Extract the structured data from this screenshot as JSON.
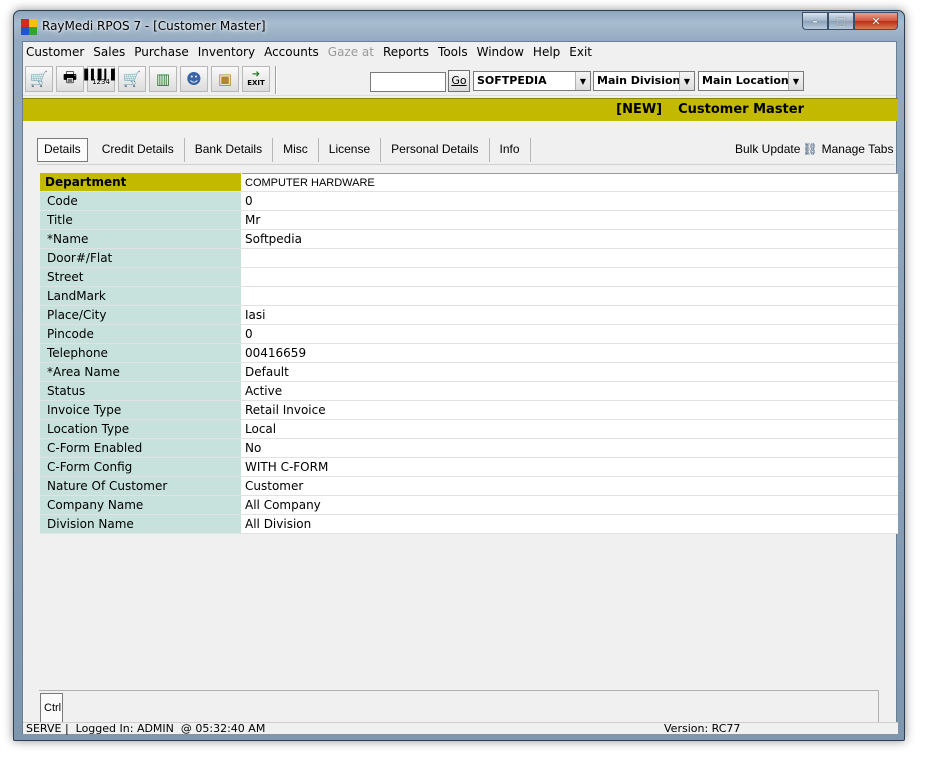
{
  "window": {
    "title": "RayMedi RPOS 7 - [Customer Master]",
    "controls": {
      "minimize": "–",
      "maximize": "□",
      "close": "✕"
    }
  },
  "menu": [
    {
      "label": "Customer",
      "disabled": false
    },
    {
      "label": "Sales",
      "disabled": false
    },
    {
      "label": "Purchase",
      "disabled": false
    },
    {
      "label": "Inventory",
      "disabled": false
    },
    {
      "label": "Accounts",
      "disabled": false
    },
    {
      "label": "Gaze at",
      "disabled": true
    },
    {
      "label": "Reports",
      "disabled": false
    },
    {
      "label": "Tools",
      "disabled": false
    },
    {
      "label": "Window",
      "disabled": false
    },
    {
      "label": "Help",
      "disabled": false
    },
    {
      "label": "Exit",
      "disabled": false
    }
  ],
  "toolbar": {
    "icons": [
      "cart-icon",
      "printer-icon",
      "barcode-icon",
      "cart-add-icon",
      "books-icon",
      "users-icon",
      "box-icon",
      "exit-icon"
    ],
    "exit_label": "EXIT",
    "barcode_label": "1234",
    "search_value": "",
    "go_label": "Go",
    "company": "SOFTPEDIA",
    "division": "Main Division",
    "location": "Main Location"
  },
  "banner": {
    "status": "[NEW]",
    "title": "Customer Master"
  },
  "tabs": [
    "Details",
    "Credit Details",
    "Bank Details",
    "Misc",
    "License",
    "Personal Details",
    "Info"
  ],
  "active_tab": "Details",
  "actions": {
    "bulk_update": "Bulk Update",
    "manage_tabs": "Manage Tabs"
  },
  "fields": [
    {
      "label": "Department",
      "value": "COMPUTER HARDWARE"
    },
    {
      "label": "Code",
      "value": "0"
    },
    {
      "label": "Title",
      "value": "Mr"
    },
    {
      "label": "*Name",
      "value": "Softpedia"
    },
    {
      "label": "Door#/Flat",
      "value": ""
    },
    {
      "label": "Street",
      "value": ""
    },
    {
      "label": "LandMark",
      "value": ""
    },
    {
      "label": "Place/City",
      "value": "Iasi"
    },
    {
      "label": "Pincode",
      "value": "0"
    },
    {
      "label": "Telephone",
      "value": "00416659"
    },
    {
      "label": "*Area Name",
      "value": "Default"
    },
    {
      "label": "Status",
      "value": "Active"
    },
    {
      "label": "Invoice Type",
      "value": "Retail Invoice"
    },
    {
      "label": "Location Type",
      "value": "Local"
    },
    {
      "label": "C-Form Enabled",
      "value": "No"
    },
    {
      "label": "C-Form Config",
      "value": "WITH C-FORM"
    },
    {
      "label": "Nature Of Customer",
      "value": "Customer"
    },
    {
      "label": "Company Name",
      "value": "All Company"
    },
    {
      "label": "Division Name",
      "value": "All Division"
    }
  ],
  "bottom_tab": "Ctrl",
  "status": {
    "left": "SERVE |  Logged In: ADMIN  @ 05:32:40 AM",
    "version": "Version: RC77"
  },
  "colors": {
    "banner": "#c3ba00",
    "label_bg": "#c7e2dc",
    "window_frame": "#8fa6bd"
  }
}
